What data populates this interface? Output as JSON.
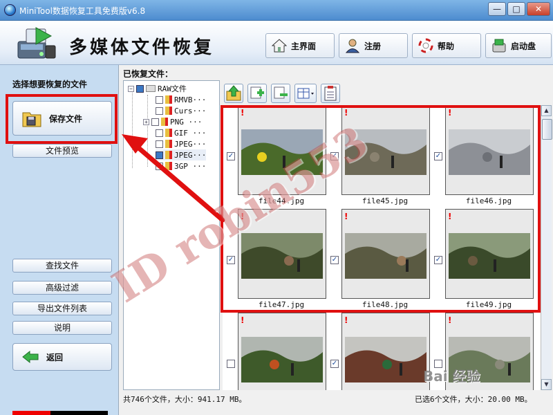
{
  "window": {
    "title": "MiniTool数据恢复工具免费版v6.8",
    "buttons": {
      "minimize": "—",
      "maximize": "□",
      "close": "✕"
    }
  },
  "header": {
    "heading": "多媒体文件恢复",
    "nav": [
      {
        "label": "主界面",
        "icon": "home-icon"
      },
      {
        "label": "注册",
        "icon": "user-icon"
      },
      {
        "label": "帮助",
        "icon": "lifebuoy-icon"
      },
      {
        "label": "启动盘",
        "icon": "boot-disk-icon"
      }
    ]
  },
  "sidebar": {
    "title": "选择想要恢复的文件",
    "save_label": "保存文件",
    "preview_label": "文件预览",
    "find_label": "查找文件",
    "filter_label": "高级过滤",
    "export_label": "导出文件列表",
    "help_label": "说明",
    "back_label": "返回"
  },
  "main": {
    "recovered_label": "已恢复文件：",
    "tree": {
      "root": "RAW文件",
      "items": [
        "RMVB···",
        "Curs···",
        "PNG ···",
        "GIF ···",
        "JPEG···",
        "JPEG···",
        "3GP ···"
      ]
    },
    "thumbnails": [
      {
        "name": "file44.jpg",
        "checked": true
      },
      {
        "name": "file45.jpg",
        "checked": true
      },
      {
        "name": "file46.jpg",
        "checked": true
      },
      {
        "name": "file47.jpg",
        "checked": true
      },
      {
        "name": "file48.jpg",
        "checked": true
      },
      {
        "name": "file49.jpg",
        "checked": true
      },
      {
        "name": "",
        "checked": false
      },
      {
        "name": "",
        "checked": true
      },
      {
        "name": "",
        "checked": false
      }
    ]
  },
  "status": {
    "left": "共746个文件，大小：941.17 MB。",
    "right": "已选6个文件，大小：20.00 MB。"
  },
  "watermarks": {
    "main": "ID robin553",
    "corner": "Bai 经验"
  },
  "colors": {
    "highlight": "#e01010",
    "accent": "#3b78c4"
  }
}
